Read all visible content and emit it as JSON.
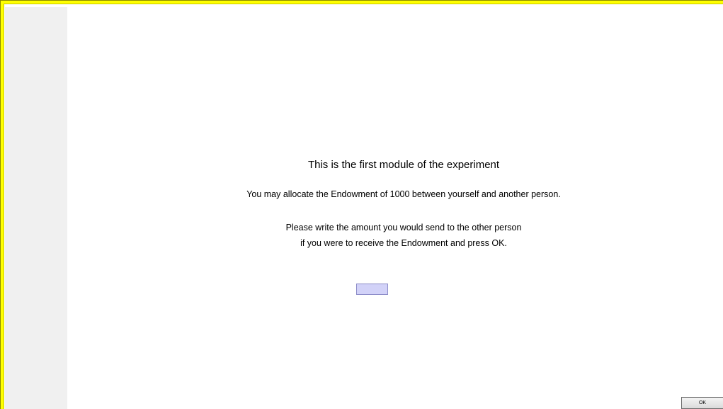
{
  "screen": {
    "title": "This is the first module of the experiment",
    "instruction_line1": "You may allocate the Endowment of 1000 between yourself and another person.",
    "instruction_line2": "Please write the amount you would send to the other person",
    "instruction_line3": "if you were to receive the Endowment and press OK."
  },
  "amount_input": {
    "value": ""
  },
  "ok_button": {
    "label": "OK"
  },
  "colors": {
    "frame": "#ffff00",
    "sidebar": "#f0f0f0",
    "input_background": "#d2d2f8"
  }
}
